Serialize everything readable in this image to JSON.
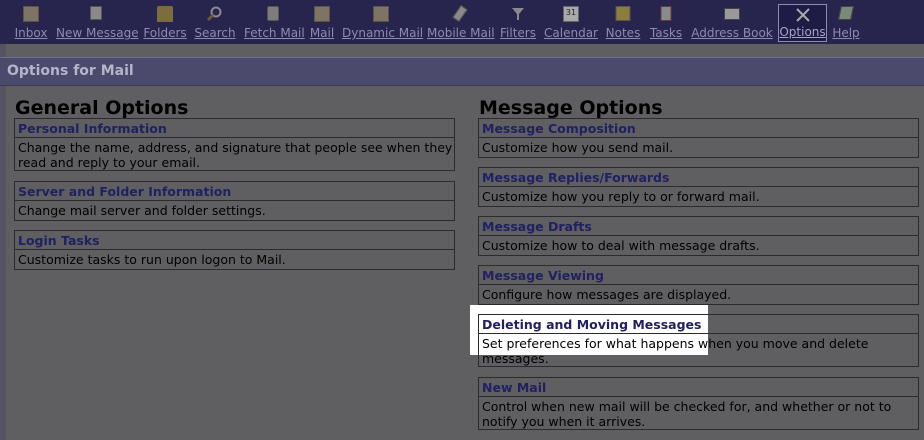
{
  "toolbar": {
    "items": [
      {
        "label": "Inbox",
        "icon": "envelope-icon"
      },
      {
        "label": "New Message",
        "icon": "compose-icon"
      },
      {
        "label": "Folders",
        "icon": "folder-icon"
      },
      {
        "label": "Search",
        "icon": "magnifier-icon"
      },
      {
        "label": "Fetch Mail",
        "icon": "fetch-mail-icon"
      },
      {
        "label": "Mail",
        "icon": "envelope-icon"
      },
      {
        "label": "Dynamic Mail",
        "icon": "envelope-icon"
      },
      {
        "label": "Mobile Mail",
        "icon": "mobile-icon"
      },
      {
        "label": "Filters",
        "icon": "funnel-icon"
      },
      {
        "label": "Calendar",
        "icon": "calendar-icon",
        "icon_text": "31"
      },
      {
        "label": "Notes",
        "icon": "notepad-icon"
      },
      {
        "label": "Tasks",
        "icon": "clipboard-icon"
      },
      {
        "label": "Address Book",
        "icon": "address-book-icon"
      },
      {
        "label": "Options",
        "icon": "tools-icon",
        "active": true
      },
      {
        "label": "Help",
        "icon": "help-book-icon"
      }
    ]
  },
  "page_title": "Options for Mail",
  "general": {
    "title": "General Options",
    "items": [
      {
        "head": "Personal Information",
        "desc": "Change the name, address, and signature that people see when they read and reply to your email."
      },
      {
        "head": "Server and Folder Information",
        "desc": "Change mail server and folder settings."
      },
      {
        "head": "Login Tasks",
        "desc": "Customize tasks to run upon logon to Mail."
      }
    ]
  },
  "message": {
    "title": "Message Options",
    "items": [
      {
        "head": "Message Composition",
        "desc": "Customize how you send mail."
      },
      {
        "head": "Message Replies/Forwards",
        "desc": "Customize how you reply to or forward mail."
      },
      {
        "head": "Message Drafts",
        "desc": "Customize how to deal with message drafts."
      },
      {
        "head": "Message Viewing",
        "desc": "Configure how messages are displayed."
      },
      {
        "head": "Deleting and Moving Messages",
        "desc": "Set preferences for what happens when you move and delete messages."
      },
      {
        "head": "New Mail",
        "desc": "Control when new mail will be checked for, and whether or not to notify you when it arrives."
      }
    ]
  },
  "colors": {
    "toolbar_bg": "#27244d",
    "header_bg": "#4b4a6c",
    "link": "#202062",
    "dim_bg": "#5f5f61"
  }
}
